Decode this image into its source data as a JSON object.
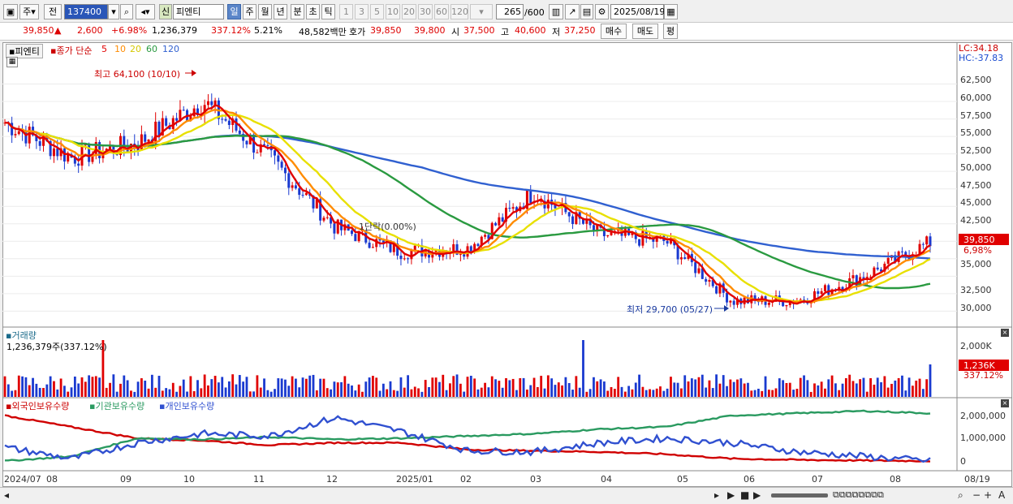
{
  "toolbar": {
    "market_label": "주",
    "market_label2": "전",
    "code": "137400",
    "new_badge": "신",
    "name": "피엔티",
    "periods": [
      "일",
      "주",
      "월",
      "년",
      "분",
      "초",
      "틱"
    ],
    "intervals": [
      "1",
      "3",
      "5",
      "10",
      "20",
      "30",
      "60",
      "120"
    ],
    "count": "265",
    "count_total": "/600",
    "date": "2025/08/19"
  },
  "quote": {
    "price": "39,850",
    "arrow": "▲",
    "change": "2,600",
    "change_pct": "+6.98%",
    "volume": "1,236,379",
    "volume_ratio": "337.12%",
    "turnover": "5.21%",
    "amount": "48,582백만",
    "bid_label": "호가",
    "ask": "39,850",
    "bid": "39,800",
    "open_label": "시",
    "open": "37,500",
    "high_label": "고",
    "high": "40,600",
    "low_label": "저",
    "low": "37,250",
    "buy_label": "매수",
    "sell_label": "매도",
    "eval_label": "평"
  },
  "price_panel": {
    "stock_name": "피엔티",
    "legend_close": "종가 단순",
    "ma": [
      {
        "label": "5",
        "color": "#e00000"
      },
      {
        "label": "10",
        "color": "#ff8c00"
      },
      {
        "label": "20",
        "color": "#e8e000"
      },
      {
        "label": "60",
        "color": "#2a9a40"
      },
      {
        "label": "120",
        "color": "#3060d0"
      }
    ],
    "lc": "LC:34.18",
    "hc": "HC:-37.83",
    "high_note": "최고 64,100 (10/10)",
    "low_note": "최저 29,700 (05/27)",
    "drop_note": "1단락(0.00%)",
    "last_price": "39,850",
    "last_pct": "6,98%",
    "y_ticks": [
      "62,500",
      "60,000",
      "57,500",
      "55,000",
      "52,500",
      "50,000",
      "47,500",
      "45,000",
      "42,500",
      "40,000",
      "37,500",
      "35,000",
      "32,500",
      "30,000"
    ]
  },
  "volume_panel": {
    "title": "거래량",
    "value": "1,236,379주(337.12%)",
    "y_tick": "2,000K",
    "last": "1,236K",
    "last_pct": "337.12%"
  },
  "holding_panel": {
    "legend": [
      "외국인보유수량",
      "기관보유수량",
      "개인보유수량"
    ],
    "colors": [
      "#d00000",
      "#2a9a60",
      "#3050d0"
    ],
    "y_ticks": [
      "2,000,000",
      "1,000,000",
      "0"
    ]
  },
  "x_ticks": [
    "2024/07",
    "08",
    "09",
    "10",
    "11",
    "12",
    "2025/01",
    "02",
    "03",
    "04",
    "05",
    "06",
    "07",
    "08",
    "08/19"
  ],
  "chart_data": {
    "type": "line",
    "title": "피엔티",
    "x": [
      "2024/07",
      "2024/08",
      "2024/09",
      "2024/10",
      "2024/11",
      "2024/12",
      "2025/01",
      "2025/02",
      "2025/03",
      "2025/04",
      "2025/05",
      "2025/06",
      "2025/07",
      "2025/08",
      "2025/08/19"
    ],
    "series": [
      {
        "name": "종가",
        "values": [
          57000,
          52000,
          54000,
          60000,
          52000,
          42000,
          38500,
          39000,
          47000,
          41000,
          40000,
          31500,
          31500,
          35000,
          39850
        ]
      }
    ],
    "ylim": [
      29000,
      65000
    ],
    "high": 64100,
    "low": 29700
  }
}
